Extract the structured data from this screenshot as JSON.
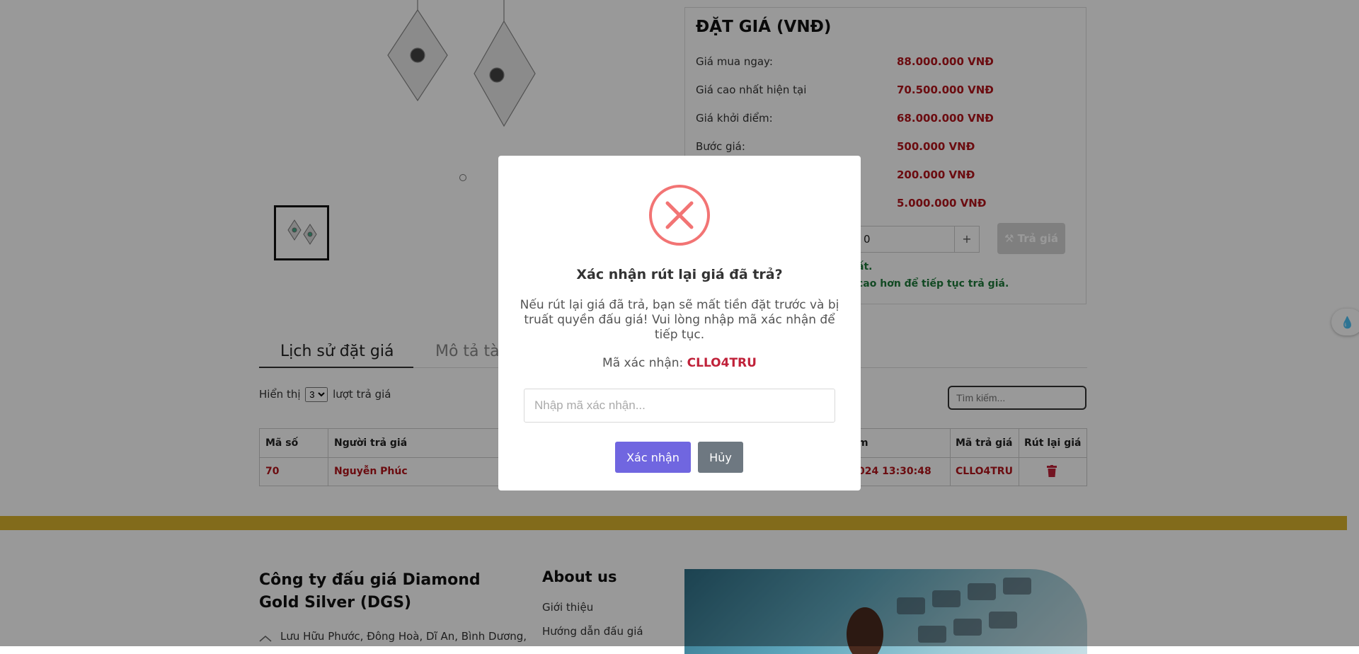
{
  "price_panel": {
    "title": "ĐẶT GIÁ (VNĐ)",
    "rows": [
      {
        "label": "Giá mua ngay:",
        "value": "88.000.000 VNĐ"
      },
      {
        "label": "Giá cao nhất hiện tại",
        "value": "70.500.000 VNĐ"
      },
      {
        "label": "Giá khởi điểm:",
        "value": "68.000.000 VNĐ"
      },
      {
        "label": "Bước giá:",
        "value": "500.000 VNĐ"
      },
      {
        "label": "",
        "value": "200.000 VNĐ"
      },
      {
        "label": "",
        "value": "5.000.000 VNĐ"
      }
    ],
    "bid_value": "0",
    "plus": "+",
    "bid_button": "Trả giá",
    "note1": "ất.",
    "note2": "cao hơn để tiếp tục trả giá."
  },
  "tabs": {
    "history": "Lịch sử đặt giá",
    "description": "Mô tả tà"
  },
  "history": {
    "show_prefix": "Hiển thị",
    "show_value": "3",
    "show_suffix": "lượt trả giá",
    "search_placeholder": "Tìm kiếm...",
    "columns": [
      "Mã số",
      "Người trả giá",
      "m",
      "Mã trả giá",
      "Rút lại giá"
    ],
    "row": {
      "id": "70",
      "bidder": "Nguyễn Phúc",
      "time": "024 13:30:48",
      "code": "CLLO4TRU"
    }
  },
  "footer": {
    "company": "Công ty đấu giá Diamond Gold Silver (DGS)",
    "address": "Lưu Hữu Phước, Đông Hoà, Dĩ An, Bình Dương,",
    "about_title": "About us",
    "links": [
      "Giới thiệu",
      "Hướng dẫn đấu giá"
    ]
  },
  "modal": {
    "title": "Xác nhận rút lại giá đã trả?",
    "text": "Nếu rút lại giá đã trả, bạn sẽ mất tiền đặt trước và bị truất quyền đấu giá! Vui lòng nhập mã xác nhận để tiếp tục.",
    "code_label": "Mã xác nhận:",
    "code_value": "CLLO4TRU",
    "input_placeholder": "Nhập mã xác nhận...",
    "confirm": "Xác nhận",
    "cancel": "Hủy"
  },
  "colors": {
    "accent_red": "#b3141c",
    "confirm_purple": "#7066e0",
    "cancel_gray": "#6e7881",
    "gold_bar": "#d9b32e",
    "error_icon": "#f27474",
    "note_green": "#1e7a3b"
  }
}
